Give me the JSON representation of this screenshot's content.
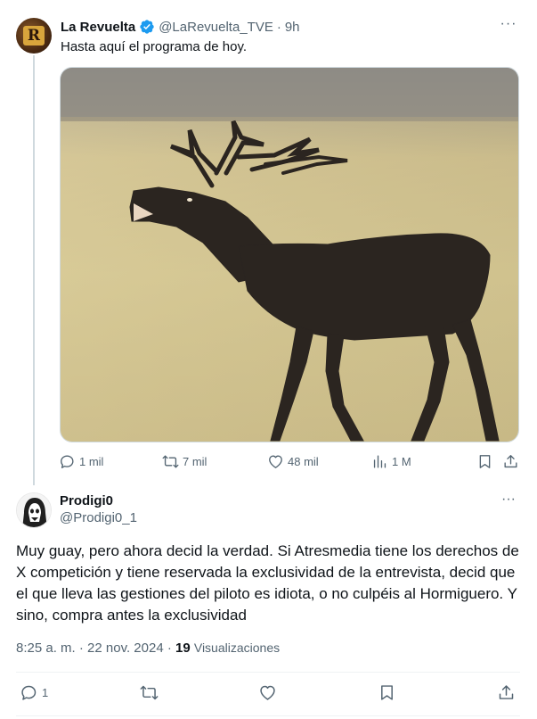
{
  "tweet1": {
    "author_name": "La Revuelta",
    "avatar_letter": "R",
    "handle": "@LaRevuelta_TVE",
    "separator": "·",
    "time": "9h",
    "text": "Hasta aquí el programa de hoy.",
    "more_label": "···",
    "media_icon": "deer-photo",
    "actions": {
      "replies": "1 mil",
      "reposts": "7 mil",
      "likes": "48 mil",
      "views": "1 M"
    }
  },
  "tweet2": {
    "author_name": "Prodigi0",
    "handle": "@Prodigi0_1",
    "more_label": "···",
    "text": "Muy guay, pero ahora decid la verdad. Si Atresmedia tiene los derechos de X competición y tiene reservada la exclusividad de la entrevista, decid que el que lleva las gestiones del piloto es idiota, o no culpéis al Hormiguero. Y sino, compra antes la exclusividad",
    "timestamp": "8:25 a. m. · 22 nov. 2024 · ",
    "views_count": "19",
    "views_label": "Visualizaciones",
    "actions": {
      "replies": "1"
    }
  },
  "colors": {
    "text_primary": "#0f1419",
    "text_secondary": "#536471",
    "verified_blue": "#1d9bf0",
    "divider": "#eff3f4"
  }
}
